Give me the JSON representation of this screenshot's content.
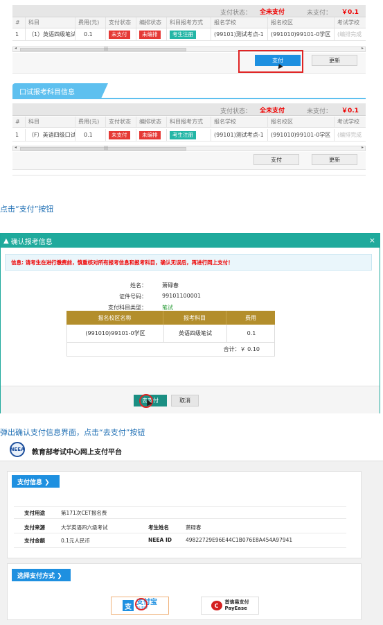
{
  "section_written": {
    "status_label": "支付状态：",
    "status_value": "全未支付",
    "unpaid_label": "未支付：",
    "unpaid_value": "￥0.1",
    "headers": [
      "#",
      "科目",
      "费用(元)",
      "支付状态",
      "编排状态",
      "科目报考方式",
      "报名学校",
      "报名校区",
      "考试学校"
    ],
    "row": {
      "index": "1",
      "subject": "（1）英语四级笔试",
      "fee": "0.1",
      "pay_status": "未支付",
      "arrange_status": "未编排",
      "mode": "考生注册",
      "school": "(99101)测试考点-1",
      "campus": "(991010)99101-0学区",
      "exam_school": "(编排完成"
    },
    "pay_button": "支付",
    "update_button": "更新"
  },
  "section_oral": {
    "tab_title": "口试报考科目信息",
    "status_label": "支付状态：",
    "status_value": "全未支付",
    "unpaid_label": "未支付：",
    "unpaid_value": "￥0.1",
    "headers": [
      "#",
      "科目",
      "费用(元)",
      "支付状态",
      "编排状态",
      "科目报考方式",
      "报名学校",
      "报名校区",
      "考试学校"
    ],
    "row": {
      "index": "1",
      "subject": "（F）英语四级口试",
      "fee": "0.1",
      "pay_status": "未支付",
      "arrange_status": "未编排",
      "mode": "考生注册",
      "school": "(99101)测试考点-1",
      "campus": "(991010)99101-0学区",
      "exam_school": "(编排完成"
    },
    "pay_button": "支付",
    "update_button": "更新"
  },
  "caption1": "点击“支付”按钮",
  "modal": {
    "title": "确认报考信息",
    "close": "×",
    "notice": "信息: 请考生在进行缴费前，慎重核对所有报考信息和报考科目，确认无误后，再进行网上支付！",
    "name_label": "姓名：",
    "name_value": "萧碌春",
    "id_label": "证件号码：",
    "id_value": "99101100001",
    "type_label": "支付科目类型：",
    "type_value": "笔试",
    "table_headers": [
      "报名校区名称",
      "报考科目",
      "费用"
    ],
    "table_row": [
      "(991010)99101-0学区",
      "英语四级笔试",
      "0.1"
    ],
    "total": "合计：￥ 0.10",
    "go_pay": "去支付",
    "cancel": "取消"
  },
  "caption2": "弹出确认支付信息界面，点击“去支付”按钮",
  "payment": {
    "platform_title": "教育部考试中心网上支付平台",
    "info_tag": "支付信息 ❯",
    "purpose_label": "支付用途",
    "purpose_value": "第171次CET报名费",
    "source_label": "支付来源",
    "source_value": "大学英语四六级考试",
    "name_label": "考生姓名",
    "name_value": "萧碌春",
    "amount_label": "支付金额",
    "amount_value": "0.1元人民币",
    "neea_label": "NEEA ID",
    "neea_value": "49822729E96E44C1B076E8A454A97941",
    "method_tag": "选择支付方式 ❯",
    "alipay": "支付宝",
    "alipay_sub": "ALIPAY",
    "payease": "首信易支付",
    "payease_sub": "PayEase"
  },
  "colors": {
    "accent_blue": "#1e90e0",
    "teal": "#1faa9c",
    "red": "#e00000",
    "gold": "#b38e2c"
  }
}
